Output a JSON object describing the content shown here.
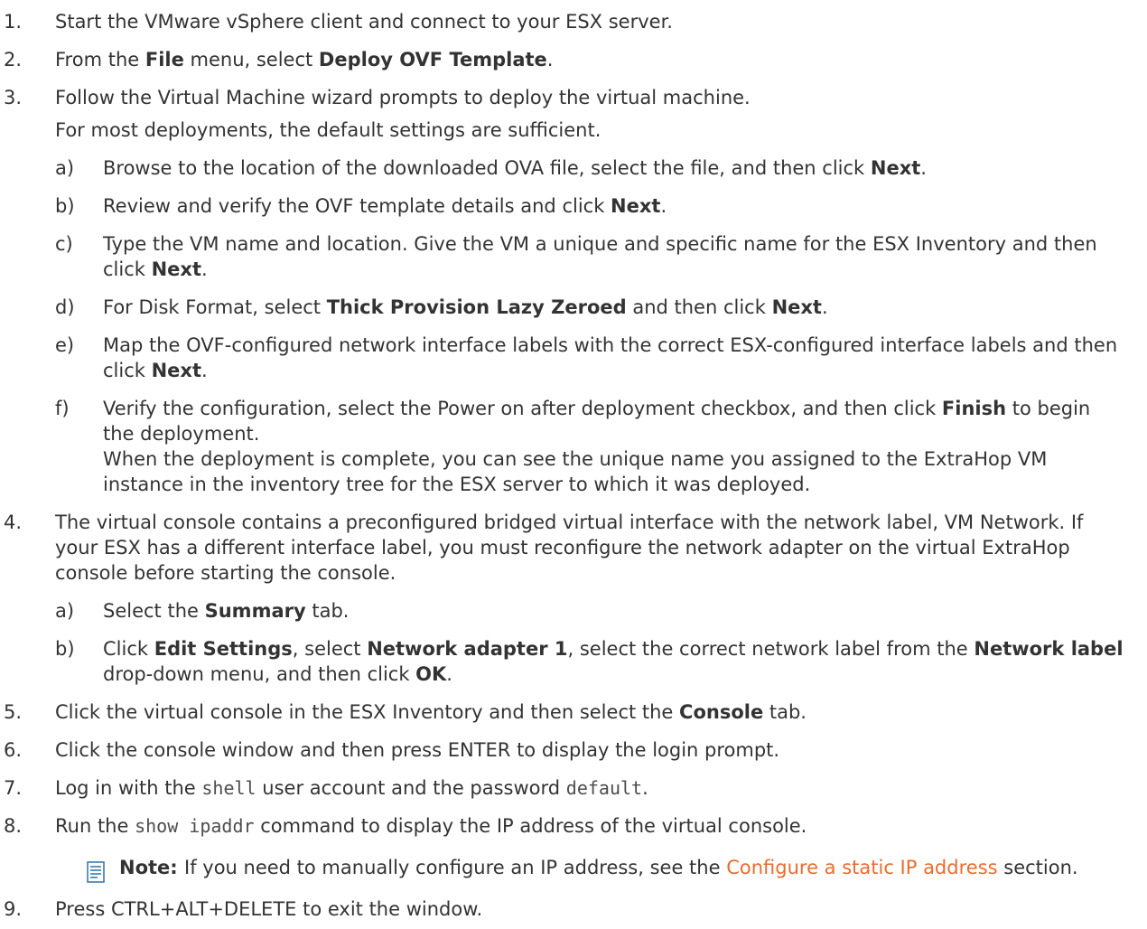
{
  "steps": [
    {
      "num": "1.",
      "text": "Start the VMware vSphere client and connect to your ESX server."
    },
    {
      "num": "2.",
      "pre": "From the ",
      "b1": "File",
      "mid": " menu, select ",
      "b2": "Deploy OVF Template",
      "post": "."
    },
    {
      "num": "3.",
      "line1": "Follow the Virtual Machine wizard prompts to deploy the virtual machine.",
      "line2": "For most deployments, the default settings are sufficient."
    },
    {
      "num": "4.",
      "text": "The virtual console contains a preconfigured bridged virtual interface with the network label, VM Network. If your ESX has a different interface label, you must reconfigure the network adapter on the virtual ExtraHop console before starting the console."
    },
    {
      "num": "5.",
      "pre": "Click the virtual console in the ESX Inventory and then select the ",
      "b1": "Console",
      "post": " tab."
    },
    {
      "num": "6.",
      "text": "Click the console window and then press ENTER to display the login prompt."
    },
    {
      "num": "7.",
      "pre": "Log in with the ",
      "code1": "shell",
      "mid": " user account and the password ",
      "code2": "default",
      "post": "."
    },
    {
      "num": "8.",
      "pre": "Run the ",
      "code1": "show ipaddr",
      "post": " command to display the IP address of the virtual console."
    },
    {
      "num": "9.",
      "text": "Press CTRL+ALT+DELETE to exit the window."
    }
  ],
  "substeps3": [
    {
      "letter": "a)",
      "pre": "Browse to the location of the downloaded OVA file, select the file, and then click ",
      "b1": "Next",
      "post": "."
    },
    {
      "letter": "b)",
      "pre": "Review and verify the OVF template details and click ",
      "b1": "Next",
      "post": "."
    },
    {
      "letter": "c)",
      "pre": "Type the VM name and location. Give the VM a unique and specific name for the ESX Inventory and then click ",
      "b1": "Next",
      "post": "."
    },
    {
      "letter": "d)",
      "pre": "For Disk Format, select ",
      "b1": "Thick Provision Lazy Zeroed",
      "mid": " and then click ",
      "b2": "Next",
      "post": "."
    },
    {
      "letter": "e)",
      "pre": "Map the OVF-configured network interface labels with the correct ESX-configured interface labels and then click ",
      "b1": "Next",
      "post": "."
    },
    {
      "letter": "f)",
      "pre": "Verify the configuration, select the Power on after deployment checkbox, and then click ",
      "b1": "Finish",
      "post": " to begin the deployment.",
      "extra": "When the deployment is complete, you can see the unique name you assigned to the ExtraHop VM instance in the inventory tree for the ESX server to which it was deployed."
    }
  ],
  "substeps4": [
    {
      "letter": "a)",
      "pre": "Select the ",
      "b1": "Summary",
      "post": " tab."
    },
    {
      "letter": "b)",
      "pre": "Click ",
      "b1": "Edit Settings",
      "mid": ", select ",
      "b2": "Network adapter 1",
      "mid2": ", select the correct network label from the ",
      "b3": "Network label",
      "post": " drop-down menu, and then click ",
      "b4": "OK",
      "post2": "."
    }
  ],
  "note": {
    "label": "Note:",
    "pre": "If you need to manually configure an IP address, see the ",
    "link": "Configure a static IP address",
    "post": " section."
  },
  "colors": {
    "text": "#333333",
    "link": "#ec6b2d"
  }
}
